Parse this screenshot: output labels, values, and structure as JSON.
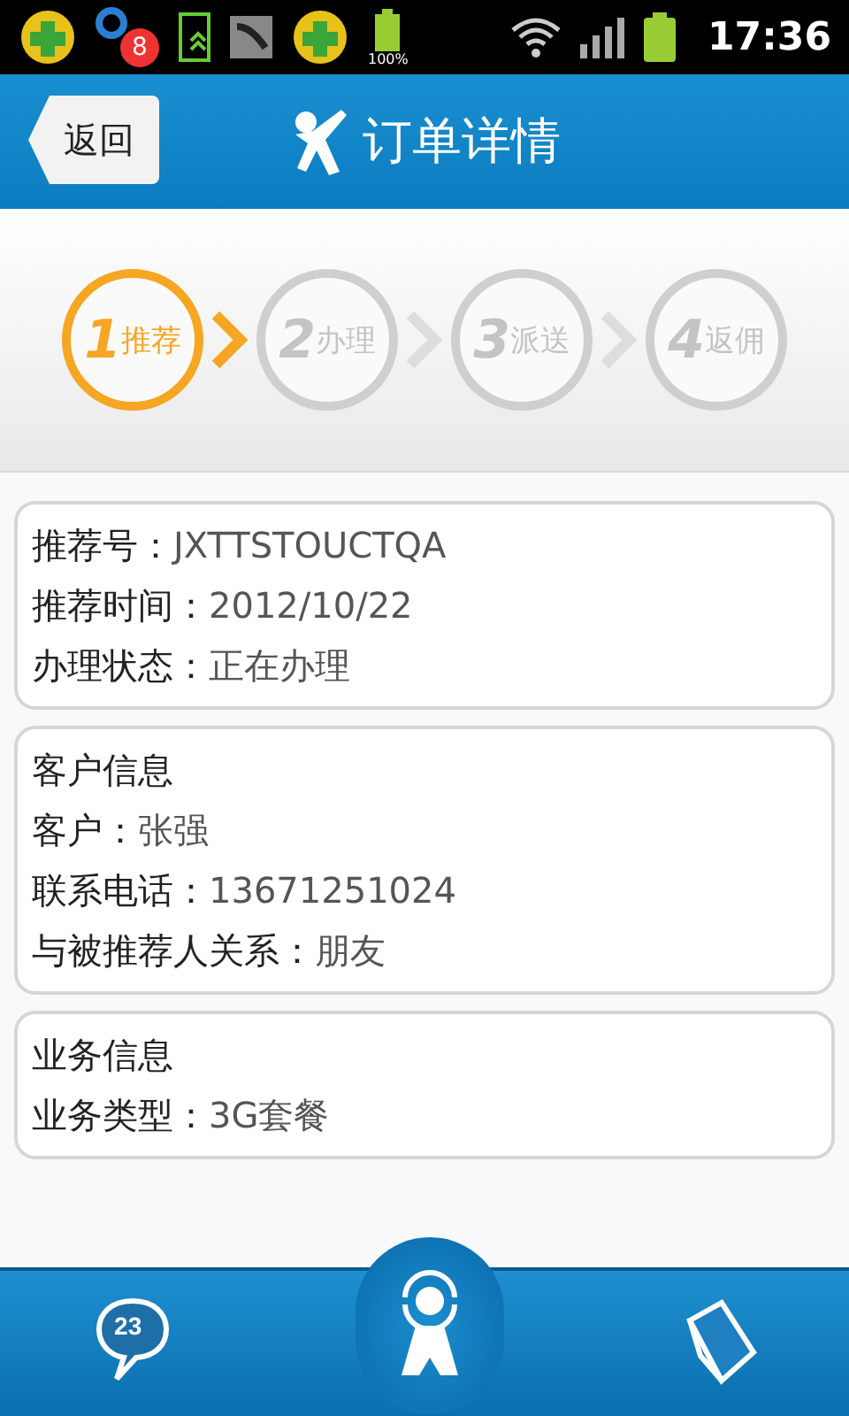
{
  "status_bar": {
    "badge": "8",
    "battery_percent": "100%",
    "time": "17:36"
  },
  "header": {
    "back": "返回",
    "title": "订单详情"
  },
  "steps": [
    {
      "number": "1",
      "label": "推荐",
      "selected": true
    },
    {
      "number": "2",
      "label": "办理",
      "selected": false
    },
    {
      "number": "3",
      "label": "派送",
      "selected": false
    },
    {
      "number": "4",
      "label": "返佣",
      "selected": false
    }
  ],
  "cards": [
    {
      "lines": [
        {
          "label": "推荐号：",
          "value": "JXTTSTOUCTQA"
        },
        {
          "label": "推荐时间：",
          "value": "2012/10/22"
        },
        {
          "label": "办理状态：",
          "value": "正在办理"
        }
      ]
    },
    {
      "heading": "客户信息",
      "lines": [
        {
          "label": "客户：",
          "value": "张强"
        },
        {
          "label": "联系电话：",
          "value": "13671251024"
        },
        {
          "label": "与被推荐人关系：",
          "value": "朋友"
        }
      ]
    },
    {
      "heading": "业务信息",
      "lines": [
        {
          "label": "业务类型：",
          "value": "3G套餐"
        }
      ]
    }
  ],
  "tab_bar": {
    "message_count": "23"
  }
}
